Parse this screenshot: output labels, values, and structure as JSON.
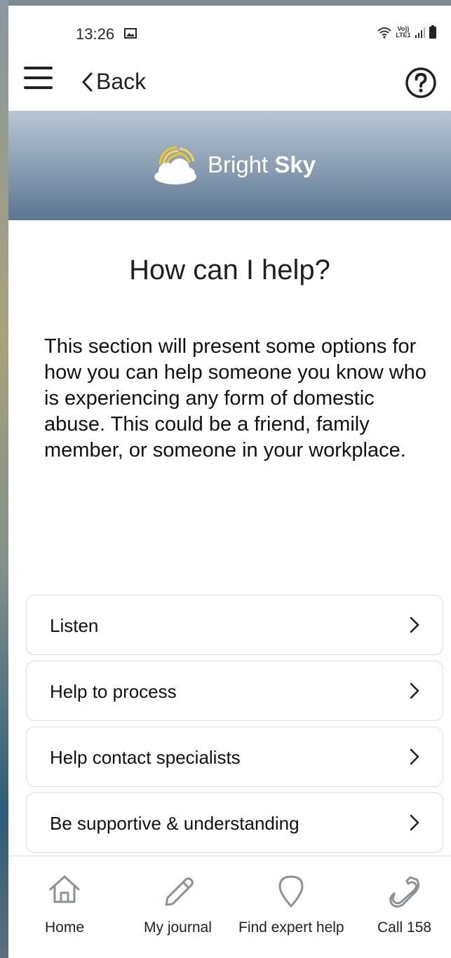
{
  "status_bar": {
    "time": "13:26",
    "icons": [
      "image-icon",
      "wifi-icon",
      "volte-lte-icon",
      "signal-icon",
      "battery-icon"
    ],
    "volte_label": "Vo)) LTE1"
  },
  "header": {
    "back_label": "Back"
  },
  "banner": {
    "brand_light": "Bright",
    "brand_bold": "Sky",
    "colors": {
      "top": "#b8c6d3",
      "bottom": "#5d7590"
    }
  },
  "main": {
    "title": "How can I help?",
    "intro": "This section will present some options for how you can help someone you know who is experiencing any form of domestic abuse. This could be a friend, family member, or someone in your workplace.",
    "options": [
      {
        "label": "Listen"
      },
      {
        "label": "Help to process"
      },
      {
        "label": "Help contact specialists"
      },
      {
        "label": "Be supportive & understanding"
      }
    ]
  },
  "bottom_nav": {
    "items": [
      {
        "label": "Home",
        "icon": "home-icon"
      },
      {
        "label": "My journal",
        "icon": "pencil-icon"
      },
      {
        "label": "Find expert help",
        "icon": "location-pin-icon"
      },
      {
        "label": "Call 158",
        "icon": "phone-icon"
      }
    ]
  }
}
